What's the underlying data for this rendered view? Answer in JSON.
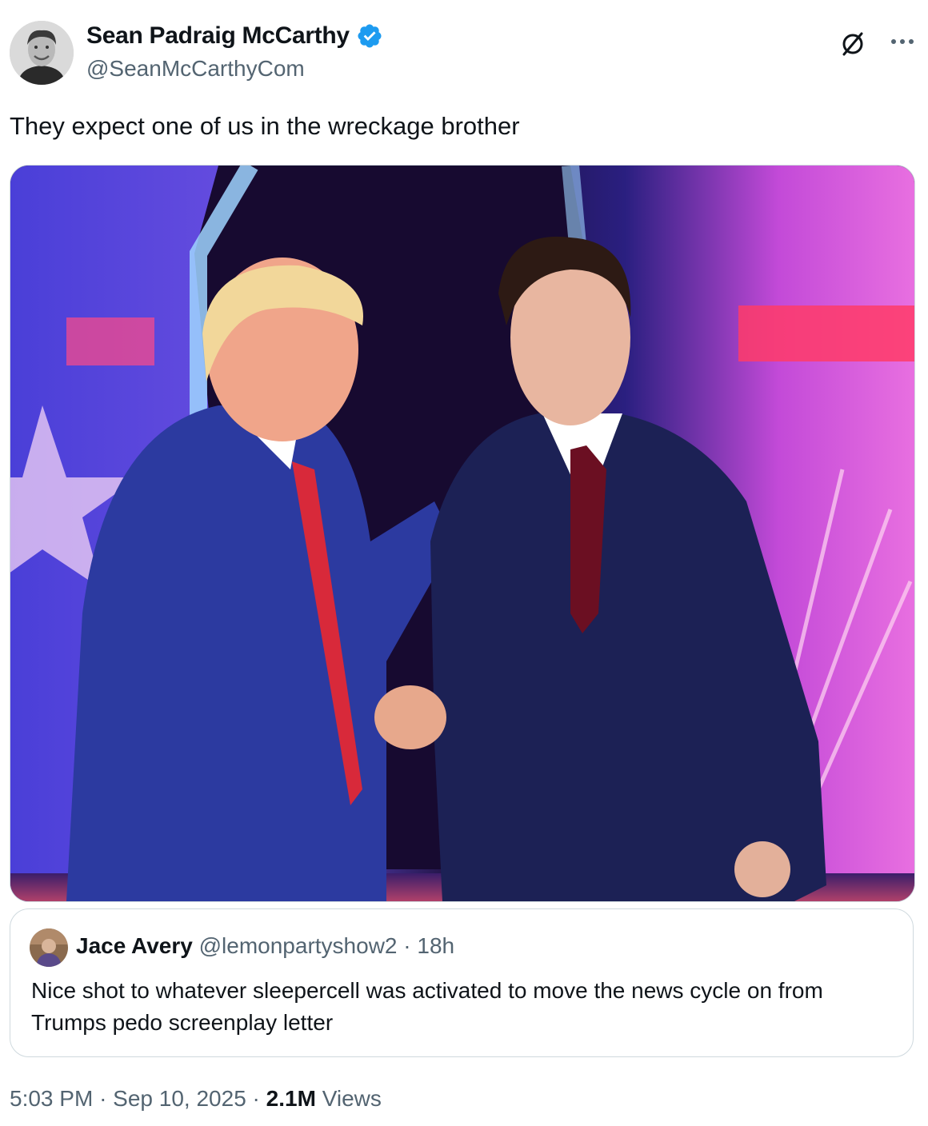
{
  "author": {
    "display_name": "Sean Padraig McCarthy",
    "handle": "@SeanMcCarthyCom",
    "verified": true,
    "avatar_icon": "profile-photo"
  },
  "header_icons": {
    "grok": "grok-icon",
    "more": "more-options-icon"
  },
  "tweet": {
    "text": "They expect one of us in the wreckage brother"
  },
  "media": {
    "type": "photo",
    "subject_icon": "two-men-handshake-photo"
  },
  "quote": {
    "display_name": "Jace Avery",
    "handle": "@lemonpartyshow2",
    "separator": "·",
    "time": "18h",
    "text": "Nice shot to whatever sleepercell was activated to move the news cycle on from Trumps pedo screenplay letter"
  },
  "footer": {
    "time": "5:03 PM",
    "sep1": "·",
    "date": "Sep 10, 2025",
    "sep2": "·",
    "views_count": "2.1M",
    "views_label": "Views"
  },
  "colors": {
    "text_primary": "#0f1419",
    "text_secondary": "#536471",
    "verified_blue": "#1d9bf0",
    "border": "#cfd9de"
  }
}
